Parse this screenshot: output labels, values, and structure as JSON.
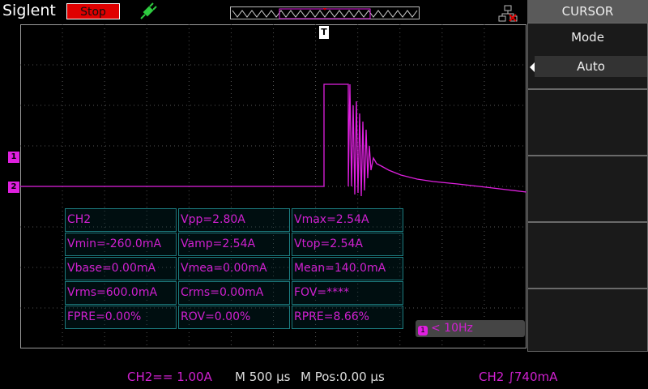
{
  "header": {
    "brand": "Siglent",
    "run_state": "Stop",
    "trigger_icon": "trigger-plug-icon",
    "usb_icon": "network-usb-icon"
  },
  "markers": {
    "ch1": "1",
    "ch2": "2",
    "trigger": "T"
  },
  "measurements": [
    [
      "CH2",
      "Vpp=2.80A",
      "Vmax=2.54A"
    ],
    [
      "Vmin=-260.0mA",
      "Vamp=2.54A",
      "Vtop=2.54A"
    ],
    [
      "Vbase=0.00mA",
      "Vmea=0.00mA",
      "Mean=140.0mA"
    ],
    [
      "Vrms=600.0mA",
      "Crms=0.00mA",
      "FOV=****"
    ],
    [
      "FPRE=0.00%",
      "ROV=0.00%",
      "RPRE=8.66%"
    ]
  ],
  "frequency": {
    "icon_label": "1",
    "text": "< 10Hz"
  },
  "status": {
    "ch2_scale": "CH2== 1.00A",
    "timebase": "M 500 μs",
    "mpos": "M Pos:0.00 μs",
    "trigger": "CH2 ∫740mA"
  },
  "menu": {
    "title": "CURSOR",
    "mode_label": "Mode",
    "mode_value": "Auto"
  },
  "colors": {
    "channel": "#e020e0",
    "stop": "#e00000",
    "grid": "#6a6a6a"
  }
}
